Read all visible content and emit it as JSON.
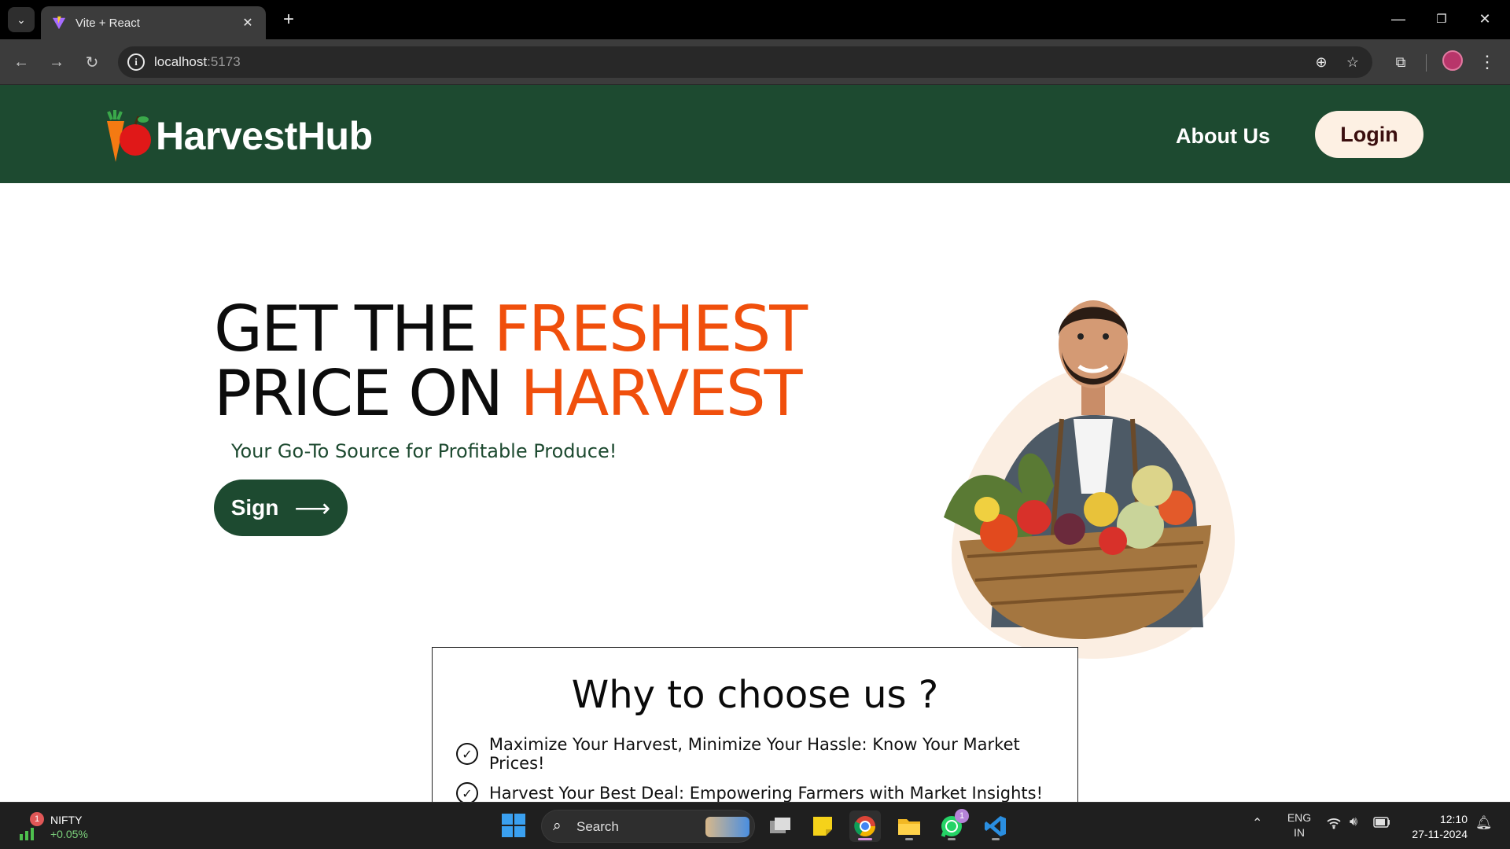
{
  "browser": {
    "tab_title": "Vite + React",
    "url_host": "localhost",
    "url_port": ":5173"
  },
  "site": {
    "brand": "HarvestHub",
    "nav_about": "About Us",
    "login": "Login",
    "hero_line1_a": "GET THE ",
    "hero_line1_b": "FRESHEST",
    "hero_line2_a": "PRICE ON ",
    "hero_line2_b": "HARVEST",
    "tagline": "Your Go-To Source for Profitable Produce!",
    "sign_label": "Sign",
    "why_title": "Why to choose us ?",
    "why_items": [
      "Maximize Your Harvest, Minimize Your Hassle: Know Your Market Prices!",
      "Harvest Your Best Deal: Empowering Farmers with Market Insights!"
    ],
    "colors": {
      "brand_green": "#1d4a30",
      "accent_orange": "#f04f0c",
      "login_bg": "#fdf0e3"
    }
  },
  "taskbar": {
    "widget_name": "NIFTY",
    "widget_change": "+0.05%",
    "widget_badge": "1",
    "search_label": "Search",
    "whatsapp_badge": "1",
    "lang_top": "ENG",
    "lang_bottom": "IN",
    "time": "12:10",
    "date": "27-11-2024"
  }
}
